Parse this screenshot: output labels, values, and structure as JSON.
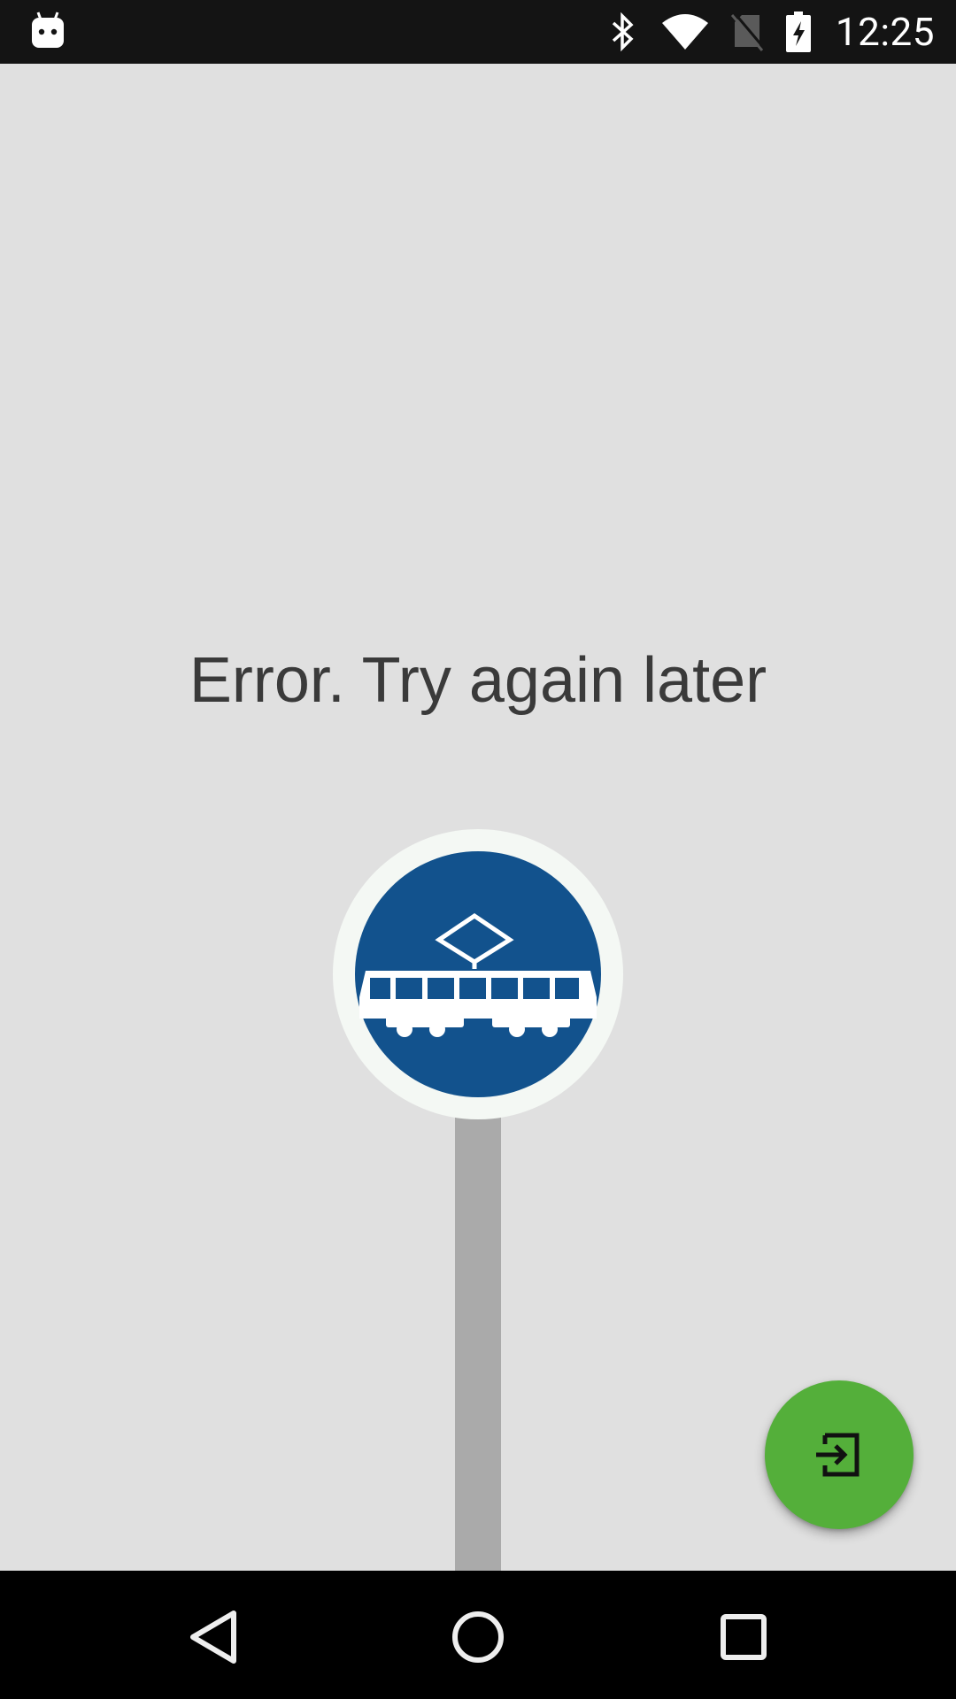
{
  "status_bar": {
    "time": "12:25",
    "icons": [
      "android-icon",
      "bluetooth-icon",
      "wifi-icon",
      "no-sim-icon",
      "battery-charging-icon"
    ]
  },
  "main": {
    "error_message": "Error. Try again later",
    "sign_icon": "tram-icon"
  },
  "fab": {
    "icon": "login-icon",
    "color": "#54af3a"
  },
  "nav_bar": {
    "buttons": [
      "back-icon",
      "home-icon",
      "recents-icon"
    ]
  },
  "colors": {
    "background": "#e0e0e0",
    "sign_blue": "#12528d",
    "fab_green": "#54af3a"
  }
}
